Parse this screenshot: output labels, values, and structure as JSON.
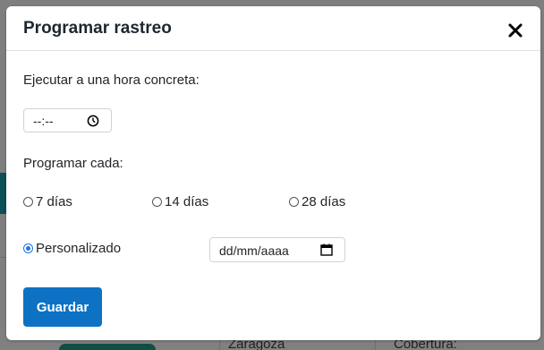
{
  "background": {
    "city_text": "Zaragoza",
    "coverage_text": "Cobertura:"
  },
  "modal": {
    "title": "Programar rastreo",
    "close_icon": "close-icon"
  },
  "schedule_time": {
    "label": "Ejecutar a una hora concreta:",
    "value": "--:--",
    "icon": "clock-icon"
  },
  "frequency": {
    "label": "Programar cada:",
    "options": [
      {
        "label": "7 días",
        "checked": false
      },
      {
        "label": "14 días",
        "checked": false
      },
      {
        "label": "28 días",
        "checked": false
      },
      {
        "label": "Personalizado",
        "checked": true
      }
    ]
  },
  "custom_date": {
    "value": "dd/mm/aaaa",
    "icon": "calendar-icon"
  },
  "save_button": {
    "label": "Guardar"
  },
  "colors": {
    "primary": "#0d72c4",
    "radio_checked": "#1a73e8",
    "overlay": "#7f7f7f"
  }
}
